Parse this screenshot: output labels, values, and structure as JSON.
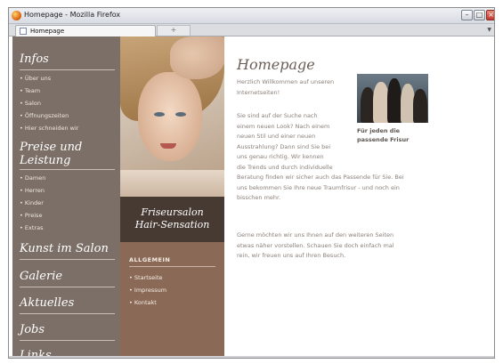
{
  "window": {
    "title": "Homepage - Mozilla Firefox"
  },
  "tabs": [
    {
      "label": "Homepage"
    }
  ],
  "newtab_symbol": "+",
  "sidebar": {
    "sections": [
      {
        "heading": "Infos",
        "items": [
          "Über uns",
          "Team",
          "Salon",
          "Öffnungszeiten",
          "Hier schneiden wir"
        ]
      },
      {
        "heading_line1": "Preise und",
        "heading_line2": "Leistung",
        "items": [
          "Damen",
          "Herren",
          "Kinder",
          "Preise",
          "Extras"
        ]
      },
      {
        "heading": "Kunst im Salon",
        "items": []
      },
      {
        "heading": "Galerie",
        "items": []
      },
      {
        "heading": "Aktuelles",
        "items": []
      },
      {
        "heading": "Jobs",
        "items": []
      },
      {
        "heading": "Links",
        "items": []
      }
    ],
    "bullet": "•"
  },
  "salon": {
    "line1": "Friseursalon",
    "line2": "Hair-Sensation"
  },
  "allgemein": {
    "title": "ALLGEMEIN",
    "items": [
      "Startseite",
      "Impressum",
      "Kontakt"
    ]
  },
  "main": {
    "title": "Homepage",
    "intro_lines": [
      "Herzlich Willkommen auf unseren",
      "Internetseiten!"
    ],
    "para1_lines": [
      "Sie sind auf der Suche nach",
      "einem neuen Look? Nach einem",
      "neuen Stil und einer neuen",
      "Ausstrahlung? Dann sind Sie bei",
      "uns genau richtig. Wir kennen",
      "die Trends und durch individuelle",
      "Beratung finden wir sicher auch das Passende für Sie. Bei",
      "uns bekommen Sie Ihre neue Traumfrisur - und noch ein",
      "bisschen mehr."
    ],
    "para2_lines": [
      "Gerne möchten wir uns Ihnen auf den weiteren Seiten",
      "etwas näher vorstellen. Schauen Sie doch einfach mal",
      "rein, wir freuen uns auf Ihren Besuch."
    ],
    "caption_line1": "Für jeden die",
    "caption_line2": "passende Frisur"
  },
  "colors": {
    "sidebar_bg": "#7b6f67",
    "salon_box_bg": "#473a33",
    "allgemein_bg": "#8a6a56",
    "title_color": "#6b5e56",
    "text_color": "#8a7f78"
  }
}
